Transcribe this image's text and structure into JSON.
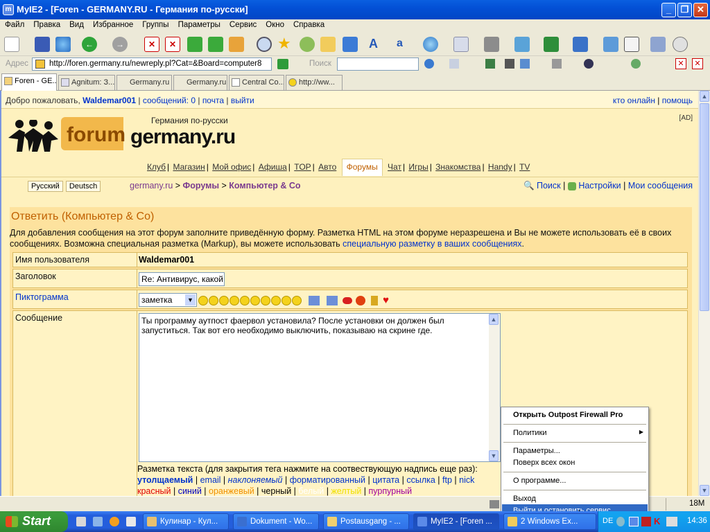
{
  "window": {
    "title": "MyIE2 - [Foren - GERMANY.RU - Германия по-русски]"
  },
  "menu": [
    "Файл",
    "Правка",
    "Вид",
    "Избранное",
    "Группы",
    "Параметры",
    "Сервис",
    "Окно",
    "Справка"
  ],
  "address": {
    "label": "Адрес",
    "url": "http://foren.germany.ru/newreply.pl?Cat=&Board=computer8",
    "search_label": "Поиск"
  },
  "tabs": [
    "Foren - GE...",
    "Agnitum: З...",
    "Germany.ru",
    "Germany.ru",
    "Central Co...",
    "http://ww..."
  ],
  "page": {
    "welcome": "Добро пожаловать,",
    "user": "Waldemar001",
    "messages": "сообщений: 0",
    "mail": "почта",
    "logout": "выйти",
    "online": "кто онлайн",
    "help": "помощь",
    "ad": "[AD]",
    "logo_forum": "forum",
    "logo_sub": "Германия по-русски",
    "logo_site": "germany.ru",
    "nav": [
      "Клуб",
      "Магазин",
      "Мой офис",
      "Афиша",
      "TOP",
      "Авто",
      "Форумы",
      "Чат",
      "Игры",
      "Знакомства",
      "Handy",
      "TV"
    ],
    "lang_ru": "Русский",
    "lang_de": "Deutsch",
    "crumb_site": "germany.ru",
    "crumb_forums": "Форумы",
    "crumb_board": "Компьютер & Co",
    "search": "Поиск",
    "settings": "Настройки",
    "my_messages": "Мои сообщения",
    "form_title": "Ответить (Компьютер & Co)",
    "form_desc_1": "Для добавления сообщения на этот форум заполните приведённую форму. Разметка HTML на этом форуме неразрешена и Вы не можете использовать её в своих сообщениях. Возможна специальная разметка (Markup), вы можете использовать",
    "form_desc_link": "специальную разметку в ваших сообщениях",
    "label_user": "Имя пользователя",
    "value_user": "Waldemar001",
    "label_subject": "Заголовок",
    "value_subject": "Re: Антивирус, какой",
    "label_icon": "Пиктограмма",
    "value_icon": "заметка",
    "label_message": "Сообщение",
    "message_text": "Ты программу аутпост фаервол установила? После установки он должен был запуститься. Так вот его необходимо выключить, показываю на скрине где.",
    "markup_hint": "Разметка текста (для закрытия тега нажмите на соотвествующую надпись еще раз):",
    "markup_links": [
      "утолщаемый",
      "email",
      "наклоняемый",
      "форматированный",
      "цитата",
      "ссылка",
      "ftp",
      "nick"
    ],
    "colors": [
      "красный",
      "синий",
      "оранжевый",
      "черный",
      "белый",
      "желтый",
      "пурпурный"
    ]
  },
  "context_menu": {
    "items": [
      "Открыть Outpost Firewall Pro",
      "Политики",
      "Параметры...",
      "Поверх всех окон",
      "О программе...",
      "Выход",
      "Выйти и остановить сервис"
    ]
  },
  "status": {
    "mem": "18M"
  },
  "taskbar": {
    "start": "Start",
    "tasks": [
      "Кулинар - Кул...",
      "Dokument - Wo...",
      "Postausgang - ...",
      "MyIE2 - [Foren ...",
      "2 Windows Ex..."
    ],
    "lang": "DE",
    "clock": "14:36"
  },
  "colors": {
    "page_bg": "#FEF1BE",
    "link": "#0033CC",
    "accent": "#C06000",
    "highlight": "#316AC5"
  }
}
